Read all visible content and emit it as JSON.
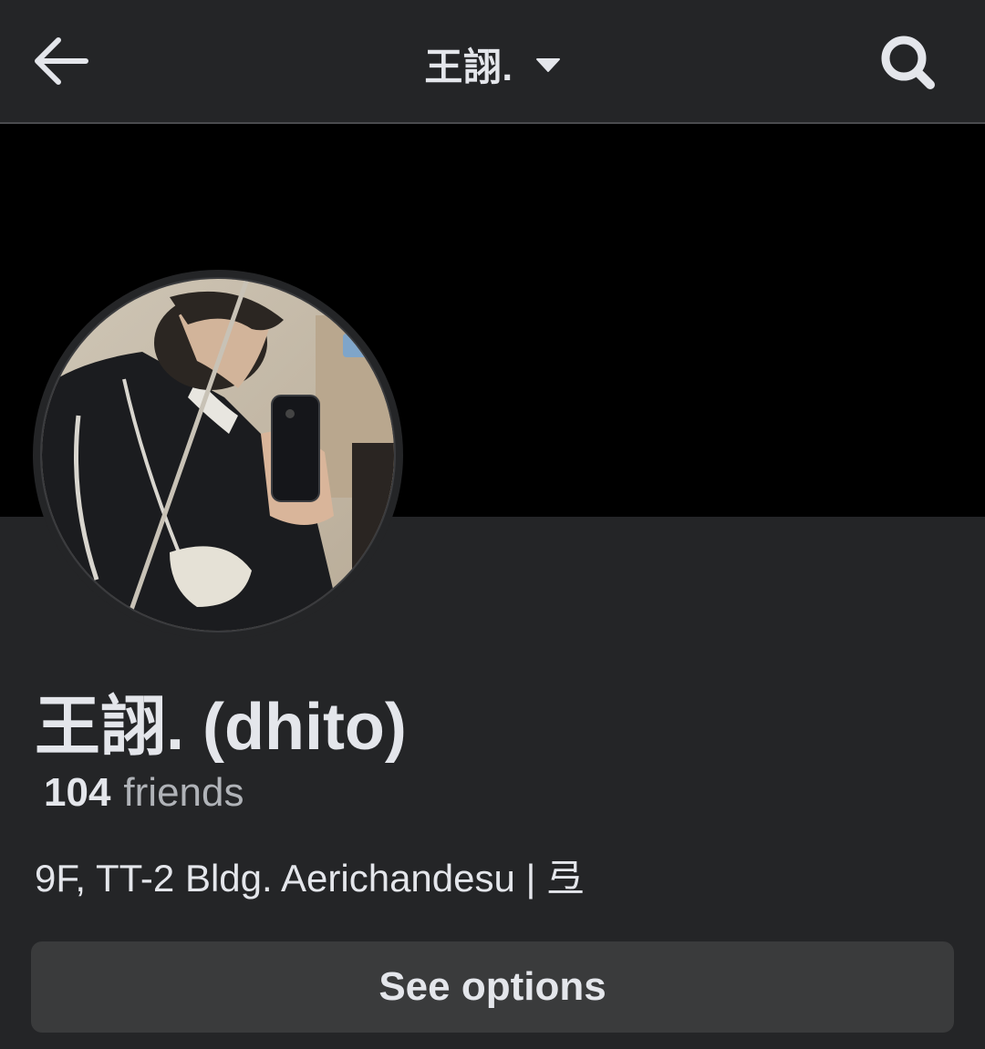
{
  "header": {
    "title": "王詡.",
    "back_icon": "arrow-left-icon",
    "dropdown_icon": "caret-down-icon",
    "search_icon": "search-icon"
  },
  "profile": {
    "name": "王詡. (dhito)",
    "friends_count": "104",
    "friends_label": "friends",
    "bio": "9F, TT-2 Bldg. Aerichandesu | 弖"
  },
  "actions": {
    "see_options_label": "See options"
  },
  "colors": {
    "background": "#242527",
    "cover": "#000000",
    "text_primary": "#e4e6eb",
    "text_secondary": "#b0b3b8",
    "button_bg": "#3a3b3c"
  }
}
